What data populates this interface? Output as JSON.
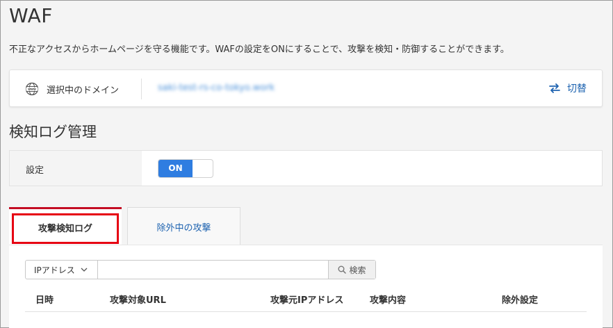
{
  "header": {
    "title": "WAF",
    "description": "不正なアクセスからホームページを守る機能です。WAFの設定をONにすることで、攻撃を検知・防御することができます。"
  },
  "domain": {
    "icon": "www-globe-icon",
    "label": "選択中のドメイン",
    "value": "saki-test-rs-co-tokyo.work",
    "switch_label": "切替",
    "switch_icon": "swap-arrows-icon",
    "accent_color": "#1e63b0"
  },
  "detection": {
    "section_title": "検知ログ管理",
    "setting_label": "設定",
    "toggle_label": "ON",
    "toggle_color": "#2f7de1"
  },
  "tabs": [
    {
      "label": "攻撃検知ログ",
      "active": true
    },
    {
      "label": "除外中の攻撃",
      "active": false
    }
  ],
  "search": {
    "filter_selected": "IPアドレス",
    "input_value": "",
    "button_label": "検索"
  },
  "table": {
    "columns": [
      "日時",
      "攻撃対象URL",
      "攻撃元IPアドレス",
      "攻撃内容",
      "除外設定"
    ]
  },
  "colors": {
    "highlight_red": "#e60012",
    "tab_top_border": "#c30d23"
  }
}
